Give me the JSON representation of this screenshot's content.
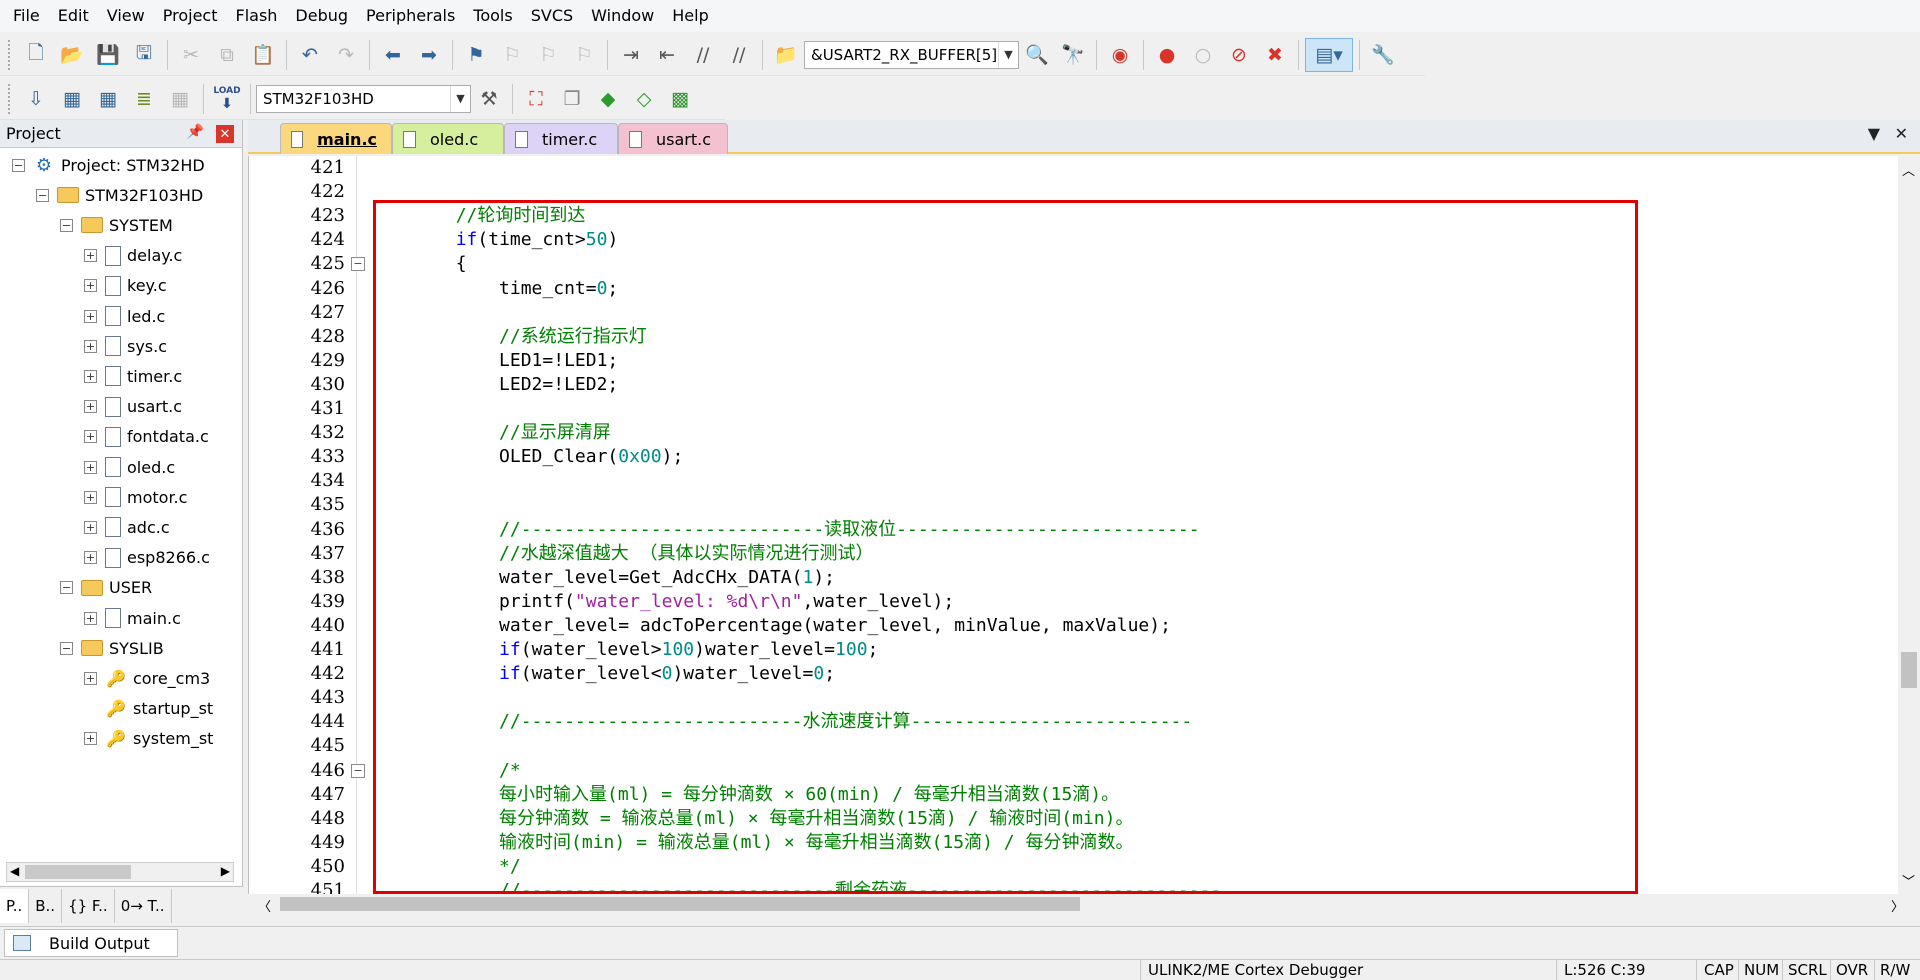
{
  "menu": [
    "File",
    "Edit",
    "View",
    "Project",
    "Flash",
    "Debug",
    "Peripherals",
    "Tools",
    "SVCS",
    "Window",
    "Help"
  ],
  "toolbar": {
    "find_value": "&USART2_RX_BUFFER[5]",
    "target_value": "STM32F103HD",
    "load_label": "LOAD"
  },
  "project_panel": {
    "title": "Project",
    "tree": [
      {
        "label": "Project: STM32HD",
        "icon": "project-icon",
        "level": 0
      },
      {
        "label": "STM32F103HD",
        "icon": "target-folder-icon",
        "level": 1
      },
      {
        "label": "SYSTEM",
        "icon": "folder-icon",
        "level": 2
      },
      {
        "label": "delay.c",
        "icon": "file-icon",
        "level": 3
      },
      {
        "label": "key.c",
        "icon": "file-icon",
        "level": 3
      },
      {
        "label": "led.c",
        "icon": "file-icon",
        "level": 3
      },
      {
        "label": "sys.c",
        "icon": "file-icon",
        "level": 3
      },
      {
        "label": "timer.c",
        "icon": "file-icon",
        "level": 3
      },
      {
        "label": "usart.c",
        "icon": "file-icon",
        "level": 3
      },
      {
        "label": "fontdata.c",
        "icon": "file-icon",
        "level": 3
      },
      {
        "label": "oled.c",
        "icon": "file-icon",
        "level": 3
      },
      {
        "label": "motor.c",
        "icon": "file-icon",
        "level": 3
      },
      {
        "label": "adc.c",
        "icon": "file-icon",
        "level": 3
      },
      {
        "label": "esp8266.c",
        "icon": "file-icon",
        "level": 3
      },
      {
        "label": "USER",
        "icon": "folder-icon",
        "level": 2
      },
      {
        "label": "main.c",
        "icon": "file-icon",
        "level": 3
      },
      {
        "label": "SYSLIB",
        "icon": "folder-icon",
        "level": 2
      },
      {
        "label": "core_cm3",
        "icon": "key-file-icon",
        "level": 3
      },
      {
        "label": "startup_st",
        "icon": "key-file-icon",
        "level": 3
      },
      {
        "label": "system_st",
        "icon": "key-file-icon",
        "level": 3
      }
    ],
    "tabs": [
      "P..",
      "B..",
      "{} F..",
      "0→ T.."
    ]
  },
  "editor_tabs": [
    {
      "label": "main.c",
      "color": "#fbd77e",
      "active": true
    },
    {
      "label": "oled.c",
      "color": "#d6ef9e"
    },
    {
      "label": "timer.c",
      "color": "#dcd3f7"
    },
    {
      "label": "usart.c",
      "color": "#f3c1cf"
    }
  ],
  "line_numbers": [
    "421",
    "422",
    "423",
    "424",
    "425",
    "426",
    "427",
    "428",
    "429",
    "430",
    "431",
    "432",
    "433",
    "434",
    "435",
    "436",
    "437",
    "438",
    "439",
    "440",
    "441",
    "442",
    "443",
    "444",
    "445",
    "446",
    "447",
    "448",
    "449",
    "450",
    "451"
  ],
  "code_lines": [
    [],
    [],
    [
      {
        "t": "        //轮询时间到达",
        "c": "cm"
      }
    ],
    [
      {
        "t": "        ",
        "c": ""
      },
      {
        "t": "if",
        "c": "kw"
      },
      {
        "t": "(time_cnt>",
        "c": ""
      },
      {
        "t": "50",
        "c": "nm"
      },
      {
        "t": ")",
        "c": ""
      }
    ],
    [
      {
        "t": "        {",
        "c": ""
      }
    ],
    [
      {
        "t": "            time_cnt=",
        "c": ""
      },
      {
        "t": "0",
        "c": "nm"
      },
      {
        "t": ";",
        "c": ""
      }
    ],
    [],
    [
      {
        "t": "            //系统运行指示灯",
        "c": "cm"
      }
    ],
    [
      {
        "t": "            LED1=!LED1;",
        "c": ""
      }
    ],
    [
      {
        "t": "            LED2=!LED2;",
        "c": ""
      }
    ],
    [],
    [
      {
        "t": "            //显示屏清屏",
        "c": "cm"
      }
    ],
    [
      {
        "t": "            OLED_Clear(",
        "c": ""
      },
      {
        "t": "0x00",
        "c": "nm"
      },
      {
        "t": ");",
        "c": ""
      }
    ],
    [],
    [],
    [
      {
        "t": "            //----------------------------读取液位----------------------------",
        "c": "cm"
      }
    ],
    [
      {
        "t": "            //水越深值越大 （具体以实际情况进行测试）",
        "c": "cm"
      }
    ],
    [
      {
        "t": "            water_level=Get_AdcCHx_DATA(",
        "c": ""
      },
      {
        "t": "1",
        "c": "nm"
      },
      {
        "t": ");",
        "c": ""
      }
    ],
    [
      {
        "t": "            printf(",
        "c": ""
      },
      {
        "t": "\"water_level: %d\\r\\n\"",
        "c": "st"
      },
      {
        "t": ",water_level);",
        "c": ""
      }
    ],
    [
      {
        "t": "            water_level= adcToPercentage(water_level, minValue, maxValue);",
        "c": ""
      }
    ],
    [
      {
        "t": "            ",
        "c": ""
      },
      {
        "t": "if",
        "c": "kw"
      },
      {
        "t": "(water_level>",
        "c": ""
      },
      {
        "t": "100",
        "c": "nm"
      },
      {
        "t": ")water_level=",
        "c": ""
      },
      {
        "t": "100",
        "c": "nm"
      },
      {
        "t": ";",
        "c": ""
      }
    ],
    [
      {
        "t": "            ",
        "c": ""
      },
      {
        "t": "if",
        "c": "kw"
      },
      {
        "t": "(water_level<",
        "c": ""
      },
      {
        "t": "0",
        "c": "nm"
      },
      {
        "t": ")water_level=",
        "c": ""
      },
      {
        "t": "0",
        "c": "nm"
      },
      {
        "t": ";",
        "c": ""
      }
    ],
    [],
    [
      {
        "t": "            //--------------------------水流速度计算--------------------------",
        "c": "cm"
      }
    ],
    [],
    [
      {
        "t": "            /*",
        "c": "cm"
      }
    ],
    [
      {
        "t": "            每小时输入量(ml) = 每分钟滴数 × 60(min) / 每毫升相当滴数(15滴)。",
        "c": "cm"
      }
    ],
    [
      {
        "t": "            每分钟滴数 = 输液总量(ml) × 每毫升相当滴数(15滴) / 输液时间(min)。",
        "c": "cm"
      }
    ],
    [
      {
        "t": "            输液时间(min) = 输液总量(ml) × 每毫升相当滴数(15滴) / 每分钟滴数。",
        "c": "cm"
      }
    ],
    [
      {
        "t": "            */",
        "c": "cm"
      }
    ],
    [
      {
        "t": "            //-----------------------------剩余药液-----------------------------",
        "c": "cm"
      }
    ]
  ],
  "build_output": {
    "label": "Build Output"
  },
  "status": {
    "debugger": "ULINK2/ME Cortex Debugger",
    "position": "L:526 C:39",
    "caps": "CAP",
    "num": "NUM",
    "scrl": "SCRL",
    "ovr": "OVR",
    "rw": "R/W"
  },
  "colors": {
    "highlight_box": "#e00000",
    "comment": "#008000",
    "keyword": "#0000ff",
    "number": "#008b8b",
    "string": "#a020a0"
  }
}
